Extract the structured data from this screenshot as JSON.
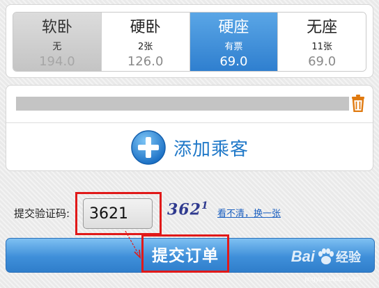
{
  "seats": [
    {
      "name": "软卧",
      "count": "无",
      "price": "194.0",
      "state": "disabled"
    },
    {
      "name": "硬卧",
      "count": "2张",
      "price": "126.0",
      "state": "normal"
    },
    {
      "name": "硬座",
      "count": "有票",
      "price": "69.0",
      "state": "selected"
    },
    {
      "name": "无座",
      "count": "11张",
      "price": "69.0",
      "state": "normal"
    }
  ],
  "passenger": {
    "add_label": "添加乘客"
  },
  "captcha": {
    "label": "提交验证码:",
    "value": "3621",
    "image_text": "362",
    "image_sup": "1",
    "refresh_label": "看不清，换一张"
  },
  "submit": {
    "label": "提交订单"
  },
  "watermark": {
    "brand": "Bai",
    "suffix": "经验",
    "url": "jingyan.baidu.com"
  },
  "colors": {
    "accent": "#2f7fcf",
    "highlight_box": "#e01919",
    "trash": "#e07a10"
  },
  "icons": {
    "trash": "trash-icon",
    "add": "plus-circle-icon",
    "arrow": "arrow-icon",
    "watermark": "paw-icon"
  }
}
